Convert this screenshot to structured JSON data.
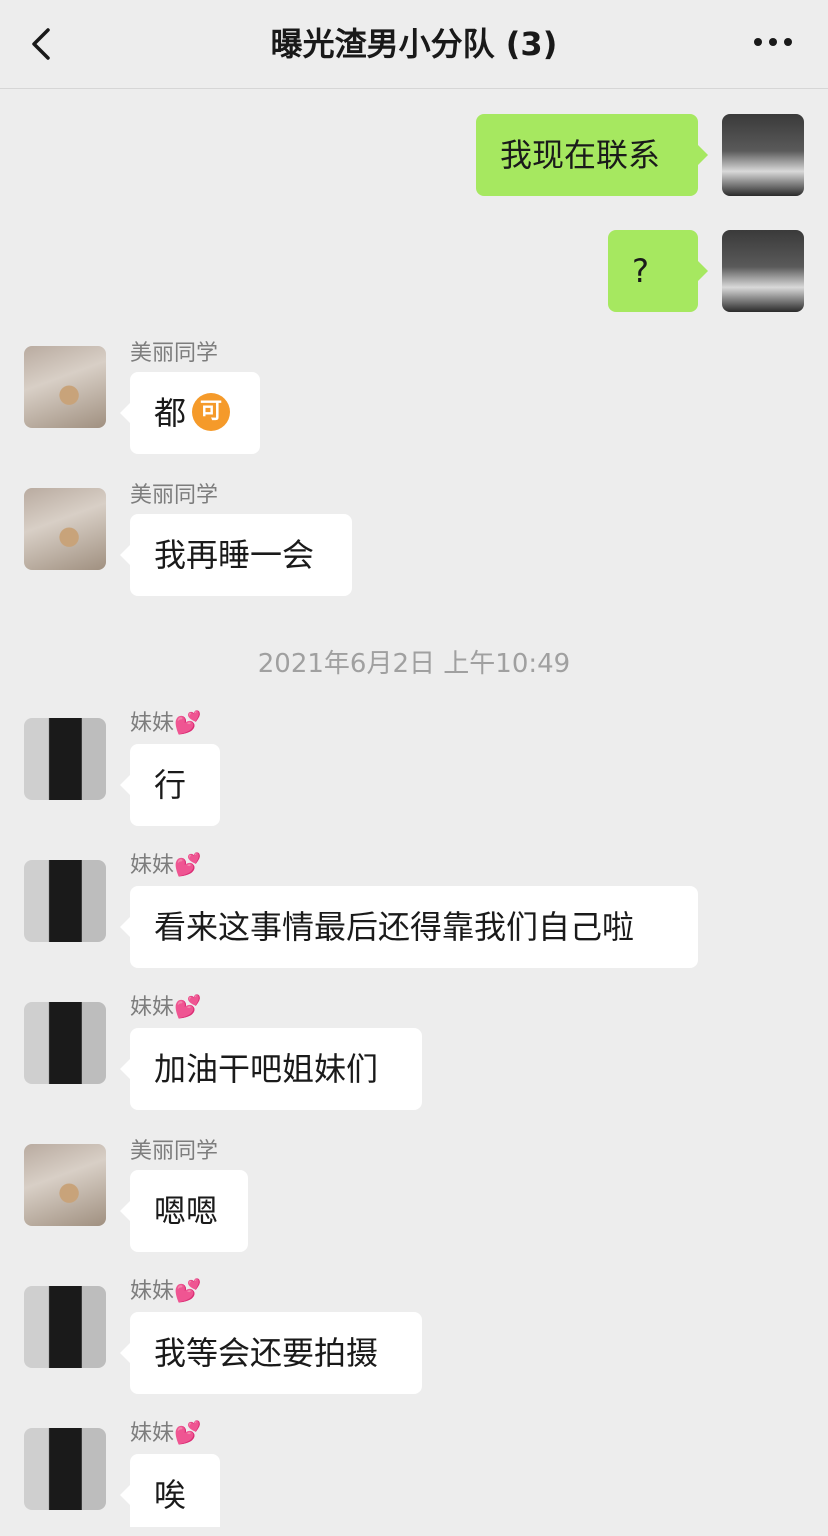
{
  "header": {
    "title": "曝光渣男小分队 (3)",
    "back_icon": "chevron-left-icon",
    "more_icon": "more-dots-icon"
  },
  "timestamp": "2021年6月2日 上午10:49",
  "senders": {
    "meili": "美丽同学",
    "meimei": "妹妹",
    "meimei_emoji": "💕"
  },
  "messages": [
    {
      "from": "me",
      "text": "我现在联系"
    },
    {
      "from": "me",
      "text": "?"
    },
    {
      "from": "meili",
      "text": "都",
      "emoji_text": "可"
    },
    {
      "from": "meili",
      "text": "我再睡一会"
    },
    {
      "from": "meimei",
      "text": "行"
    },
    {
      "from": "meimei",
      "text": "看来这事情最后还得靠我们自己啦"
    },
    {
      "from": "meimei",
      "text": "加油干吧姐妹们"
    },
    {
      "from": "meili",
      "text": "嗯嗯"
    },
    {
      "from": "meimei",
      "text": "我等会还要拍摄"
    },
    {
      "from": "meimei",
      "text": "唉"
    }
  ],
  "colors": {
    "background": "#ededed",
    "outgoing_bubble": "#a6e860",
    "incoming_bubble": "#ffffff"
  }
}
